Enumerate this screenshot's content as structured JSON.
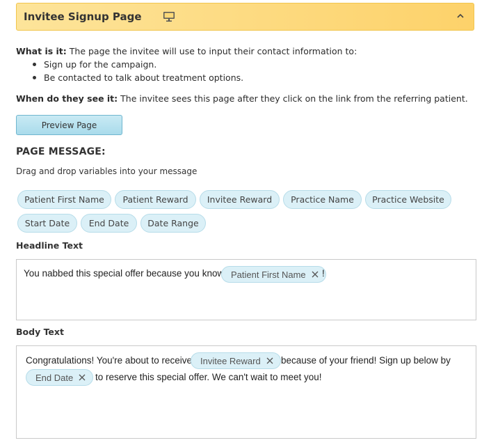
{
  "panel": {
    "title": "Invitee Signup Page",
    "icon": "desktop-monitor-icon",
    "collapse_icon": "chevron-up-icon"
  },
  "info": {
    "what_label": "What is it:",
    "what_text": " The page the invitee will use to input their contact information to:",
    "bullets": [
      "Sign up for the campaign.",
      "Be contacted to talk about treatment options."
    ],
    "when_label": "When do they see it:",
    "when_text": " The invitee sees this page after they click on the link from the referring patient."
  },
  "preview_button": {
    "label": "Preview Page"
  },
  "page_message": {
    "title": "PAGE MESSAGE:",
    "hint": "Drag and drop variables into your message",
    "variables": [
      "Patient First Name",
      "Patient Reward",
      "Invitee Reward",
      "Practice Name",
      "Practice Website",
      "Start Date",
      "End Date",
      "Date Range"
    ]
  },
  "headline": {
    "label": "Headline Text",
    "text_before": "You nabbed this special offer because you know",
    "token": "Patient First Name",
    "text_after": "!"
  },
  "body": {
    "label": "Body Text",
    "line1_before": "Congratulations! You're about to receive",
    "token1": "Invitee Reward",
    "line1_after": "because of your friend! Sign up below by",
    "token2": "End Date",
    "line2_after": "to reserve this special offer. We can't wait to meet you!"
  },
  "colors": {
    "header_bg": "#fdd26a",
    "chip_bg": "#dbf0f7",
    "button_bg": "#b5e1ef"
  }
}
